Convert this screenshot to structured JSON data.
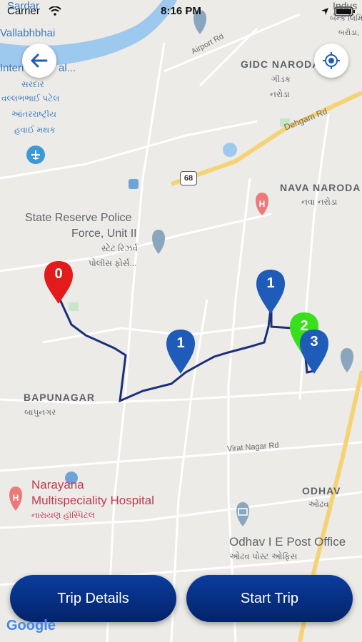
{
  "status_bar": {
    "carrier": "Carrier",
    "time": "8:16 PM"
  },
  "controls": {
    "back_icon": "arrow-left-icon",
    "locate_icon": "gps-crosshair-icon"
  },
  "map_labels": {
    "sardar_line1": "Sardar",
    "sardar_line2": "Vallabhbhai",
    "airport_cut": "Internation",
    "airport_cut2": "al...",
    "airport_guj1": "સરદાર",
    "airport_guj2": "વલ્લભભાઈ પટેલ",
    "airport_guj3": "આંતરરાષ્ટ્રીય",
    "airport_guj4": "હવાઈ મથક",
    "airport_rd": "Airport Rd",
    "gidc_en": "GIDC NARODA",
    "gidc_gu1": "ગીડક",
    "gidc_gu2": "નરોડા",
    "indus_en": "Indus",
    "indus_gu": "બેન્ક લિમિટેડ",
    "indus_gu2": "બરોડા,",
    "dehgam_rd": "Dehgam Rd",
    "highway": "68",
    "nava_naroda_en": "NAVA NARODA",
    "nava_naroda_gu": "નવા નરોડા",
    "srp_line1": "State Reserve Police",
    "srp_line2": "Force, Unit II",
    "srp_gu1": "સ્ટેટ રિઝર્વ",
    "srp_gu2": "પોલીસ ફોર્સ...",
    "bapunagar_en": "BAPUNAGAR",
    "bapunagar_gu": "બાપુનગર",
    "virat_rd": "Virat Nagar Rd",
    "narayana1": "Narayana",
    "narayana2": "Multispeciality Hospital",
    "narayana_gu": "નારાયણ હૉસ્પિટલ",
    "odhav_en": "ODHAV",
    "odhav_gu": "ઓઢવ",
    "odhav_po": "Odhav I E Post Office",
    "odhav_po_gu": "ઓઢવ પોસ્ટ ઓફિસ",
    "naroda_cut": "N"
  },
  "markers": [
    {
      "label": "0",
      "color": "#e31b1b"
    },
    {
      "label": "1",
      "color": "#1f5bb8"
    },
    {
      "label": "1",
      "color": "#1f5bb8"
    },
    {
      "label": "2",
      "color": "#38e01c"
    },
    {
      "label": "3",
      "color": "#1f5bb8"
    }
  ],
  "buttons": {
    "trip_details": "Trip Details",
    "start_trip": "Start Trip"
  },
  "google": "Google",
  "colors": {
    "route": "#1b2f7a",
    "button_top": "#0a3d9e",
    "button_bottom": "#04236a",
    "water": "#9dc9ee",
    "park": "#c8e6c9"
  }
}
